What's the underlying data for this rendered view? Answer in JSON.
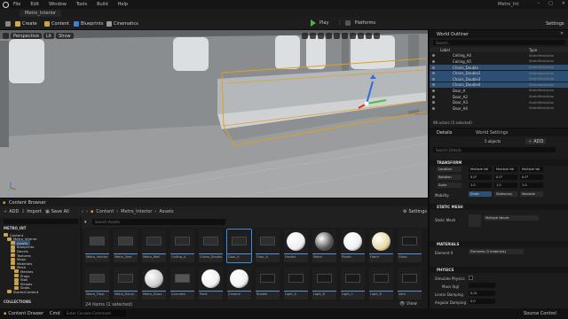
{
  "window": {
    "title": "Metro_Int"
  },
  "menu": [
    "File",
    "Edit",
    "Window",
    "Tools",
    "Build",
    "Help"
  ],
  "project_tab": "Metro_Interior",
  "toolbar": {
    "create": "Create",
    "content": "Content",
    "blueprints": "Blueprints",
    "cinematics": "Cinematics",
    "play": "Play",
    "platforms": "Platforms",
    "settings": "Settings"
  },
  "viewport": {
    "perspective": "Perspective",
    "lit": "Lit",
    "show": "Show"
  },
  "content_browser": {
    "title": "Content Browser",
    "add": "ADD",
    "import": "Import",
    "save_all": "Save All",
    "settings": "Settings",
    "breadcrumb": [
      "Content",
      "Metro_Interior",
      "Assets"
    ],
    "search_placeholder": "Search Assets",
    "project_label": "METRO_INT",
    "tree": [
      "Content",
      "Metro_Interior",
      "Assets",
      "Blueprints",
      "Decals",
      "Textures",
      "Maps",
      "Materials",
      "Mesh",
      "Meshes",
      "Props",
      "Stall",
      "Stripes",
      "Seats",
      "StarterContent"
    ],
    "collections": "COLLECTIONS",
    "status": "24 items (1 selected)",
    "assets_row1": [
      "Metro_Interior",
      "Metro_Seat",
      "Metro_Wall",
      "Ceiling_A",
      "Chairs_Double",
      "Door_A",
      "Floor_A",
      "Handle",
      "Metal",
      "Plastic",
      "Fabric",
      "Glass"
    ],
    "assets_row2": [
      "Metro_Floor",
      "Metro_Decal",
      "Metro_Glass",
      "Concrete",
      "Paint",
      "Chrome",
      "Rubber",
      "Light_A",
      "Light_B",
      "Light_C",
      "Light_D",
      "Vent"
    ]
  },
  "outliner": {
    "title": "World Outliner",
    "search_placeholder": "Search...",
    "col_label": "Label",
    "col_type": "Type",
    "rows": [
      {
        "name": "Ceiling_A4",
        "type": "StaticMeshActor",
        "selected": false
      },
      {
        "name": "Ceiling_A5",
        "type": "StaticMeshActor",
        "selected": false
      },
      {
        "name": "Chairs_Double",
        "type": "StaticMeshActor",
        "selected": true
      },
      {
        "name": "Chairs_Double2",
        "type": "StaticMeshActor",
        "selected": true
      },
      {
        "name": "Chairs_Double3",
        "type": "StaticMeshActor",
        "selected": true
      },
      {
        "name": "Chairs_Double4",
        "type": "StaticMeshActor",
        "selected": true
      },
      {
        "name": "Door_A",
        "type": "StaticMeshActor",
        "selected": false
      },
      {
        "name": "Door_A2",
        "type": "StaticMeshActor",
        "selected": false
      },
      {
        "name": "Door_A3",
        "type": "StaticMeshActor",
        "selected": false
      },
      {
        "name": "Door_A4",
        "type": "StaticMeshActor",
        "selected": false
      }
    ],
    "status": "98 actors (5 selected)"
  },
  "details": {
    "tab_details": "Details",
    "tab_world": "World Settings",
    "objects": "5 objects",
    "add": "ADD",
    "search_placeholder": "Search Details",
    "transform": "TRANSFORM",
    "location": "Location",
    "rotation": "Rotation",
    "scale": "Scale",
    "mobility": "Mobility",
    "multiple": "Multiple Val",
    "rot_vals": [
      "0.0°",
      "0.0°",
      "0.0°"
    ],
    "scale_vals": [
      "1.0",
      "1.0",
      "1.0"
    ],
    "static": "Static",
    "stationary": "Stationary",
    "movable": "Movable",
    "static_mesh": "STATIC MESH",
    "static_mesh_label": "Static Mesh",
    "static_mesh_value": "Multiple Values",
    "materials": "MATERIALS",
    "element0": "Element 0",
    "element0_value": "Elements (3 materials)",
    "physics": "PHYSICS",
    "simulate": "Simulate Physics",
    "mass": "Mass (kg)",
    "linear_damping": "Linear Damping",
    "linear_damping_val": "0.01",
    "angular_damping": "Angular Damping",
    "angular_damping_val": "0.0"
  },
  "bottom": {
    "content_drawer": "Content Drawer",
    "cmd": "Cmd",
    "cmd_placeholder": "Enter Console Command",
    "source_control": "Source Control"
  },
  "colors": {
    "accent": "#3c8fe0",
    "selection": "#2c4f73",
    "play": "#4bb543",
    "highlight": "#e0a020"
  }
}
